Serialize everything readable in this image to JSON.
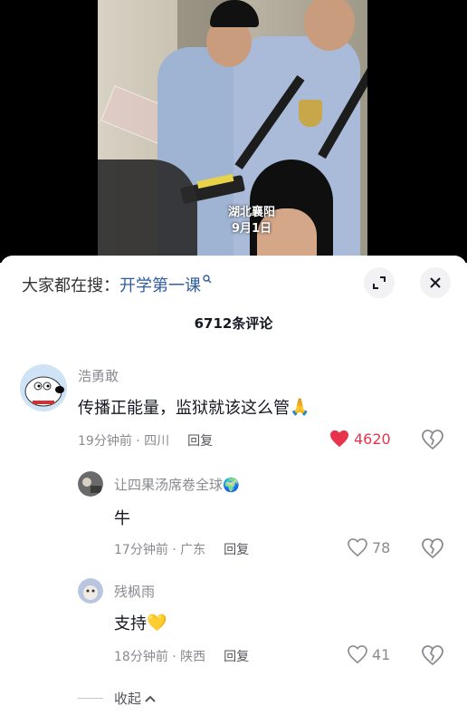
{
  "video": {
    "overlay_line1": "湖北襄阳",
    "overlay_line2": "9月1日"
  },
  "sheet": {
    "search_prefix": "大家都在搜：",
    "search_term": "开学第一课",
    "comment_count": "6712条评论",
    "collapse_label": "收起"
  },
  "comments": [
    {
      "author": "浩勇敢",
      "text": "传播正能量，监狱就该这么管",
      "emoji": "🙏",
      "time_location": "19分钟前 · 四川",
      "reply_label": "回复",
      "likes": "4620",
      "liked": true
    },
    {
      "author": "让四果汤席卷全球🌍",
      "text": "牛",
      "time_location": "17分钟前 · 广东",
      "reply_label": "回复",
      "likes": "78",
      "liked": false
    },
    {
      "author": "残枫雨",
      "text": "支持",
      "emoji": "💛",
      "time_location": "18分钟前 · 陕西",
      "reply_label": "回复",
      "likes": "41",
      "liked": false
    }
  ],
  "colors": {
    "accent_blue": "#2f5c9e",
    "like_red": "#e8334d",
    "muted_gray": "#8a8b91"
  }
}
